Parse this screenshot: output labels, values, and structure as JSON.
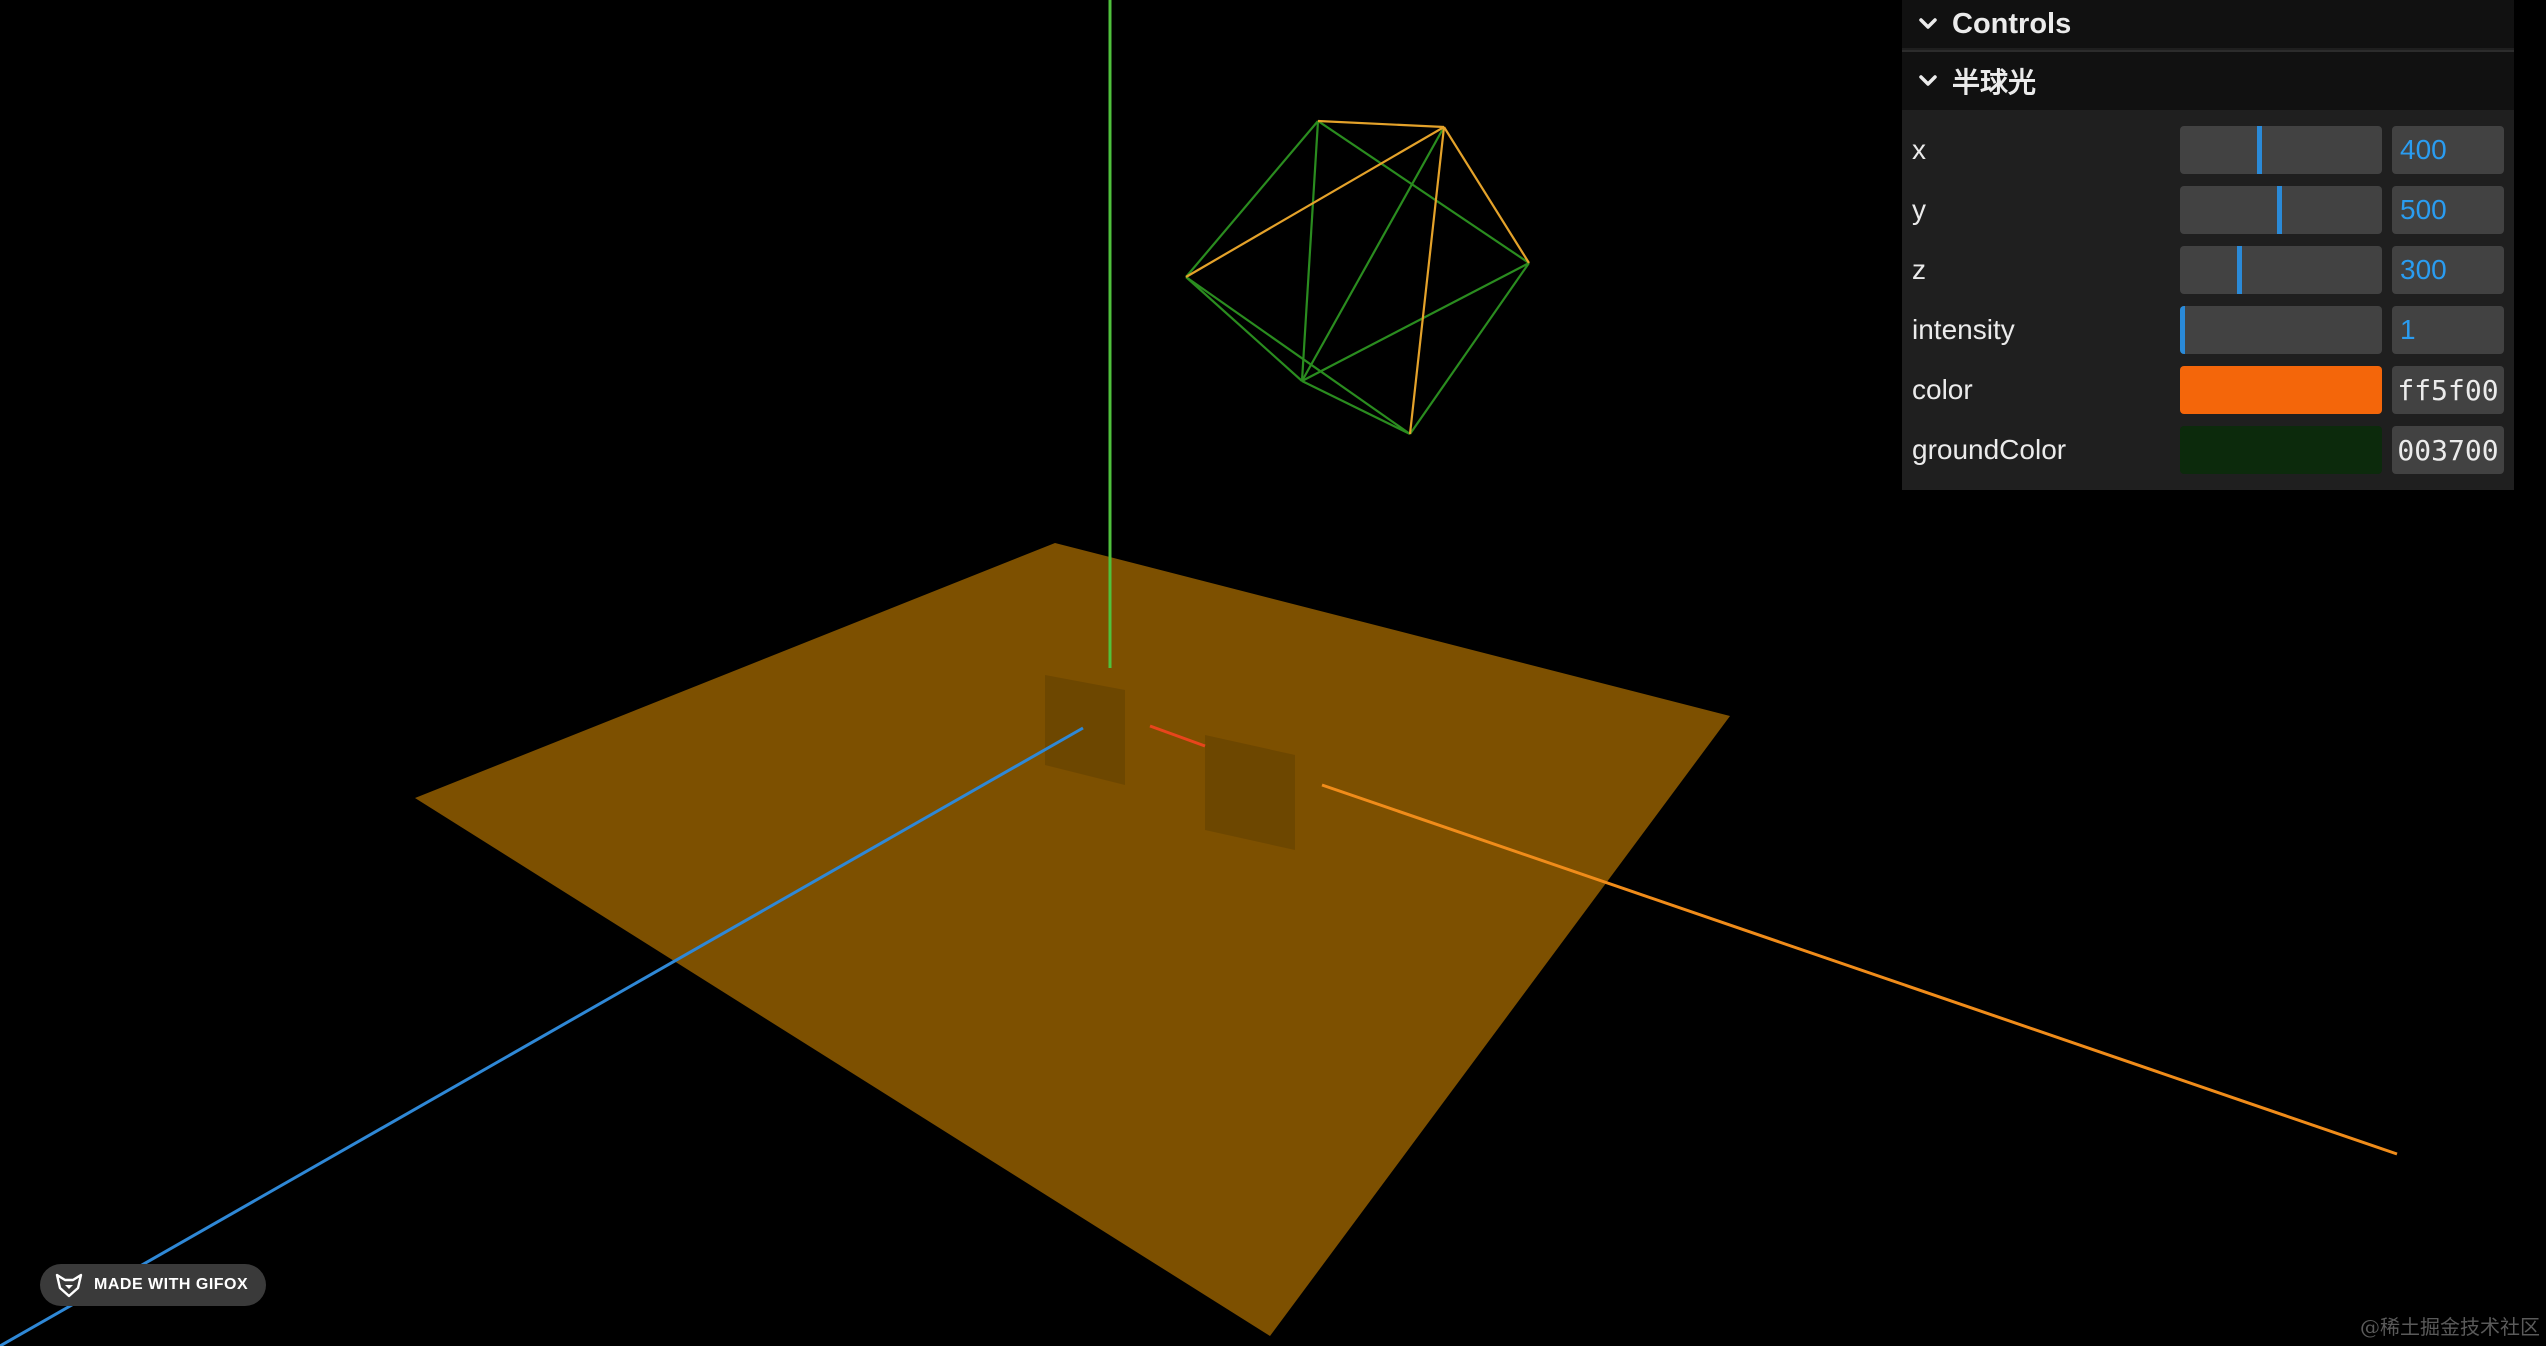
{
  "gui": {
    "title": "Controls",
    "folder": {
      "title": "半球光",
      "controls": [
        {
          "label": "x",
          "value": "400",
          "fraction": 0.39
        },
        {
          "label": "y",
          "value": "500",
          "fraction": 0.49
        },
        {
          "label": "z",
          "value": "300",
          "fraction": 0.29
        },
        {
          "label": "intensity",
          "value": "1",
          "fraction": 0.0
        },
        {
          "label": "color",
          "value": "ff5f00",
          "swatch": "#f4660a"
        },
        {
          "label": "groundColor",
          "value": "003700",
          "swatch": "#0c2a0c"
        }
      ]
    }
  },
  "badge": {
    "label": "MADE WITH GIFOX",
    "icon": "fox-icon"
  },
  "watermark": "@稀土掘金技术社区",
  "scene": {
    "plane_color": "#7d5000",
    "axis_y_color": "#4fc13d",
    "axis_z_color": "#2f88d6",
    "axis_x_color": "#f08c1a",
    "axis_x_near_color": "#e8451c",
    "helper_outline_color": "#2a8c1f",
    "helper_direction_color": "#e4a22a"
  }
}
